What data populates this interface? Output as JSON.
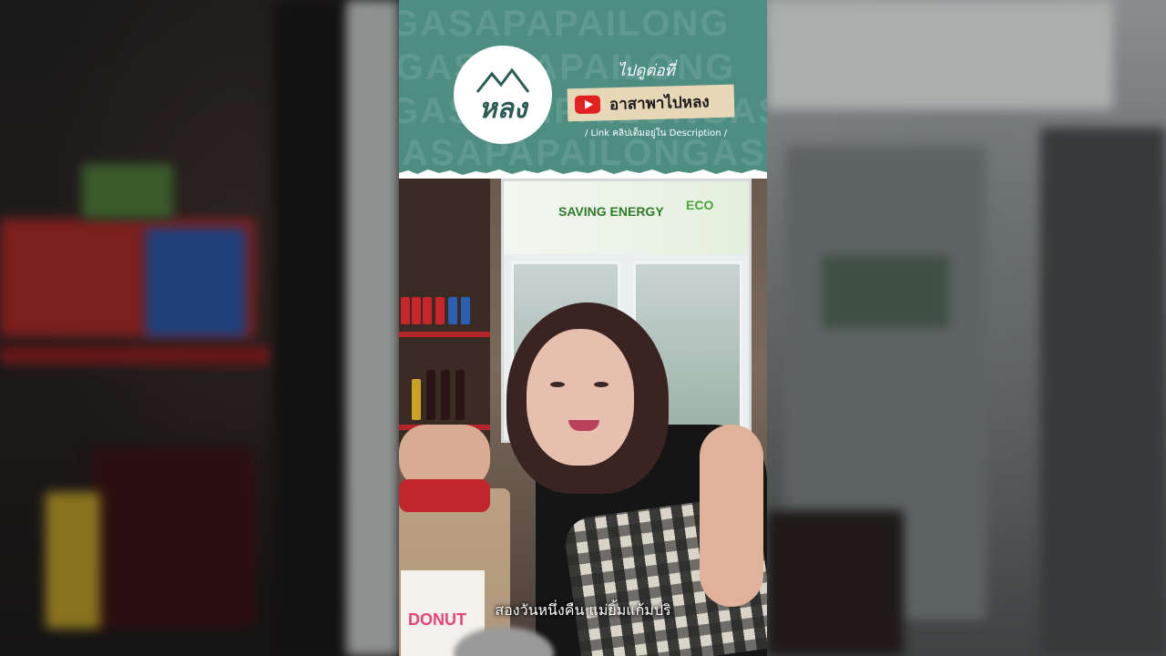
{
  "banner": {
    "background_text": [
      "GASAPAPAILONG",
      "GASAPAPAILONG",
      "GASAPAPAILONGASAP",
      "GASAPAPAILONGASAP"
    ],
    "logo_text": "หลง",
    "watch_label": "ไปดูต่อที่",
    "channel_name": "อาสาพาไปหลง",
    "link_note": "/ Link คลิปเต็มอยู่ใน Description /"
  },
  "photo": {
    "saving_energy": "SAVING ENERGY",
    "eco": "ECO",
    "donut": "DONUT"
  },
  "subtitle": "สองวันหนึ่งคืน แม่ยิ้มแก้มปริ",
  "colors": {
    "banner": "#4e8e82",
    "youtube": "#e32020",
    "tag": "#e6d7b7"
  },
  "icons": [
    "youtube-icon"
  ]
}
